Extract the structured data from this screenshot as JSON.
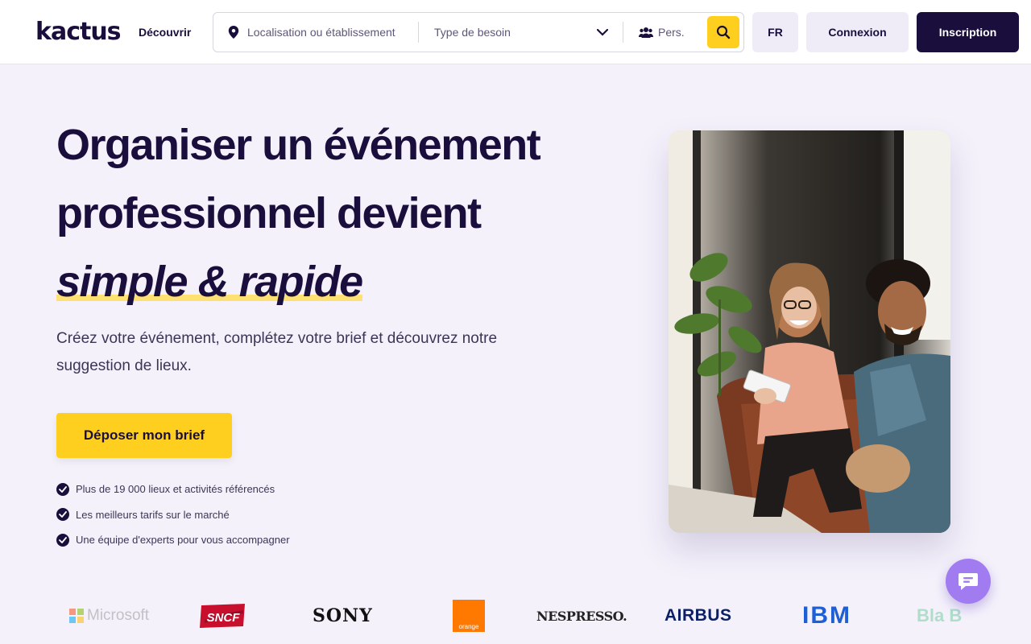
{
  "header": {
    "logo": "kactus",
    "nav_discover": "Découvrir",
    "search": {
      "location_placeholder": "Localisation ou établissement",
      "type_placeholder": "Type de besoin",
      "persons_placeholder": "Pers.",
      "search_icon": "search-icon"
    },
    "lang": "FR",
    "login": "Connexion",
    "signup": "Inscription"
  },
  "hero": {
    "title_line1": "Organiser un événement",
    "title_line2": "professionnel devient",
    "title_highlight": "simple & rapide",
    "subtitle": "Créez votre événement, complétez votre brief et découvrez notre suggestion de lieux.",
    "cta": "Déposer mon brief",
    "features": [
      "Plus de 19 000 lieux et activités référencés",
      "Les meilleurs tarifs sur le marché",
      "Une équipe d'experts pour vous accompagner"
    ]
  },
  "logos": {
    "microsoft": "Microsoft",
    "sncf": "SNCF",
    "sony": "SONY",
    "orange": "orange",
    "nespresso": "NESPRESSO.",
    "airbus": "AIRBUS",
    "ibm": "IBM",
    "blablacar": "Bla B"
  },
  "colors": {
    "primary": "#1a0f3c",
    "accent": "#ffcf1f",
    "background": "#f4f1fb",
    "chat": "#a17cf0"
  }
}
